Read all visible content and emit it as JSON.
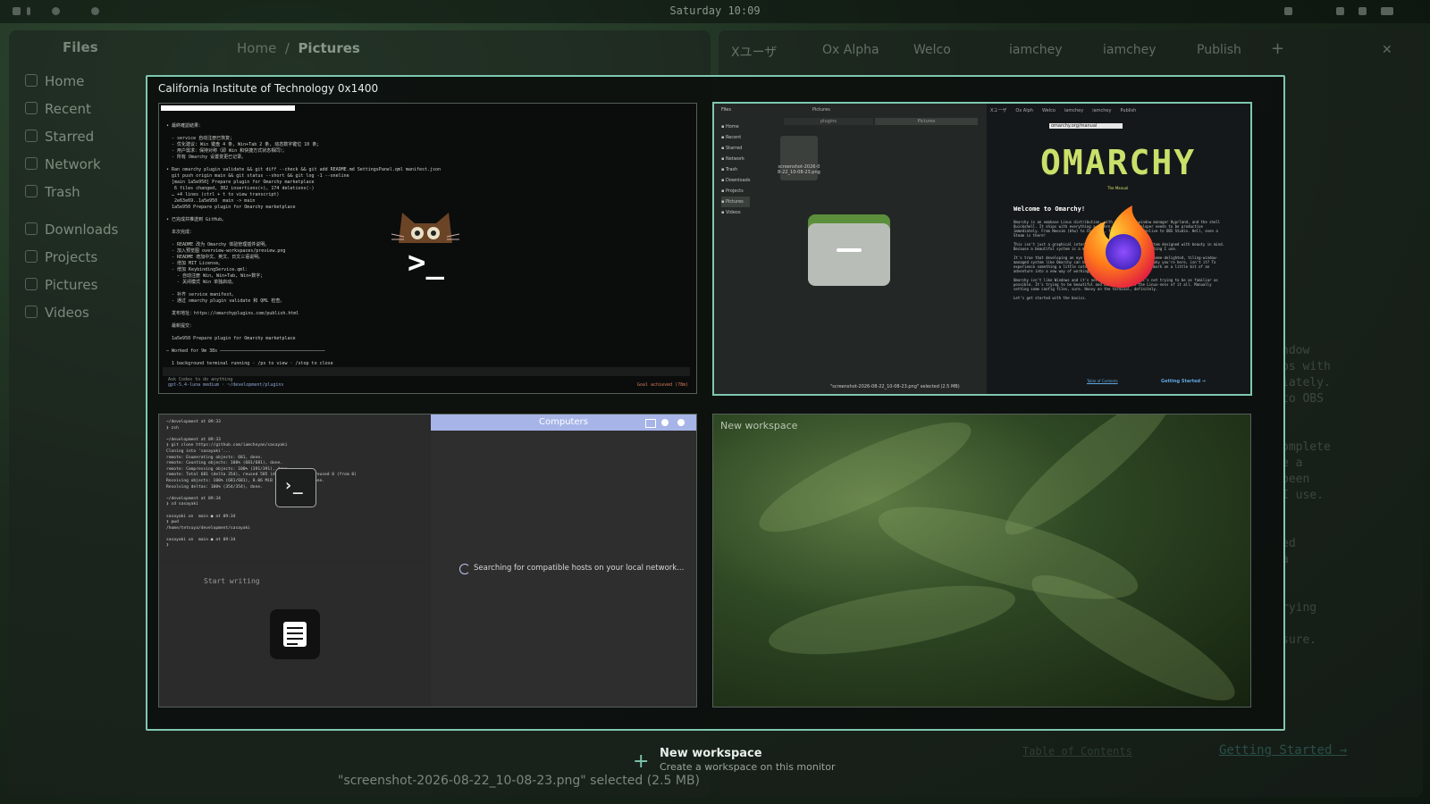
{
  "topbar": {
    "clock": "Saturday 10:09"
  },
  "files_window": {
    "title": "Files",
    "breadcrumb": [
      "Home",
      "Pictures"
    ],
    "sidebar": [
      {
        "label": "Home",
        "icon": "home-icon"
      },
      {
        "label": "Recent",
        "icon": "clock-icon"
      },
      {
        "label": "Starred",
        "icon": "star-icon"
      },
      {
        "label": "Network",
        "icon": "network-icon"
      },
      {
        "label": "Trash",
        "icon": "trash-icon"
      },
      {
        "label": "Downloads",
        "icon": "download-icon"
      },
      {
        "label": "Projects",
        "icon": "folder-icon"
      },
      {
        "label": "Pictures",
        "icon": "image-icon"
      },
      {
        "label": "Videos",
        "icon": "video-icon"
      }
    ],
    "status": "\"screenshot-2026-08-22_10-08-23.png\" selected  (2.5 MB)"
  },
  "browser_window": {
    "tabs": [
      "Xユーザ",
      "Ox Alpha",
      "Welco",
      "iamchey",
      "iamchey",
      "Publish"
    ],
    "ghost_lines": [
      "ndow",
      "ps with",
      "iately.",
      "to OBS",
      "",
      "",
      "omplete",
      "e a",
      "been",
      "I use.",
      "",
      "",
      "ed",
      "a",
      "",
      "",
      "rying",
      "",
      "sure."
    ],
    "footer_link_1": "Table of Contents",
    "footer_link_2": "Getting Started →"
  },
  "overview": {
    "title": "California Institute of Technology 0x1400",
    "ws1": {
      "terminal_lines": [
        "• 最終確認結果：",
        "",
        "  - service 自动注册已恢复；",
        "  - 优化建议: Win 键盘 4 条, Win+Tab 2 条, 动态数字键位 10 条；",
        "  - 用户需求：保持对称（即 Win 和快捷方式状态相同）；",
        "  - 所有 Omarchy 设置变更已记录。",
        "",
        "• Ran omarchy plugin validate && git diff --check && git add README.md SettingsPanel.qml manifest.json",
        "  git push origin main && git status --short && git log -1 --oneline",
        "  [main 1a5e950] Prepare plugin for Omarchy marketplace",
        "   6 files changed, 302 insertions(+), 174 deletions(-)",
        "  … +4 lines (ctrl + t to view transcript)",
        "   2e63e69..1a5e950  main -> main",
        "  1a5e950 Prepare plugin for Omarchy marketplace",
        "",
        "• 已完成并推送到 GitHub。",
        "",
        "  本次完成：",
        "",
        "  - README 改为 Omarchy 体验管理插件说明。",
        "  - 加入预览图 overview-workspaces/preview.png",
        "  - README 增加中文、英文、日文三语说明。",
        "  - 增加 MIT License。",
        "  - 增加 KeybindingService.qml：",
        "    - 自动注册 Win, Win+Tab, Win+数字；",
        "    - 关闭模式 Win 单独启动。",
        "",
        "  - 补齐 service manifest。",
        "  - 通过 omarchy plugin validate 和 QML 检查。",
        "",
        "  发布地址：https://omarchyplugins.com/publish.html",
        "",
        "  最新提交：",
        "",
        "  1a5e950 Prepare plugin for Omarchy marketplace",
        "",
        "─ Worked for 9m 38s ───────────────────────────────────────",
        "",
        "  1 background terminal running · /ps to view · /stop to close"
      ],
      "input_hint": "Ask Codex to do anything",
      "model_line": "gpt-5.4-luna medium · ~/development/plugins",
      "goal": "Goal achieved (78m)"
    },
    "ws2": {
      "files_sidebar": [
        "Home",
        "Recent",
        "Starred",
        "Network",
        "Trash",
        "Downloads",
        "Projects",
        "Pictures",
        "Videos"
      ],
      "files_tabs": [
        "plugins",
        "Pictures"
      ],
      "files_crumb": "Pictures",
      "file_name": "screenshot-2026-08-22_10-08-23.png",
      "files_status": "\"screenshot-2026-08-22_10-08-23.png\" selected (2.5 MB)",
      "browser_tabs": [
        "Xユーザ",
        "Ox Alph",
        "Welco",
        "iamchey",
        "iamchey",
        "Publish"
      ],
      "url": "omarchy.org/manual",
      "logo": "OMARCHY",
      "logo_sub": "The Manual",
      "welcome": "Welcome to Omarchy!",
      "paragraphs": [
        "Omarchy is an omakase Linux distribution, with the tiling window manager Hyprland, and the shell Quickshell. It ships with everything a modern, software developer needs to be productive immediately. From Neovim (btw) to Chromium, from Signal to Kdenlive to OBS Studio. Hell, even a Steam is there!",
        "This isn't just a graphical interface though. It's a complete system designed with beauty in mind. Because a beautiful system is a motivating system and just everything I use.",
        "It's true that developing an eye for this style of a TUI-heavy, theme-delighted, tiling-window-managed system like Omarchy can be an acquired taste. But that's why you're here, isn't it? To experience something a little outside of your comfort zone? To embark on a little bit of an adventure into a new way of working with computers? I hope so.",
        "Omarchy isn't like Windows and it's not like macOS either. It's not trying to be as familiar as possible. It's trying to be beautiful and better. Embrace the Linux-ness of it all. Manually setting some config files, sure. Hoovy on the terminal, definitely.",
        "Let's get started with the basics."
      ],
      "toc": "Table of Contents",
      "getting_started": "Getting Started →"
    },
    "ws3": {
      "term_lines": [
        "~/development at 09:33",
        "❯ zsh",
        "",
        "~/development at 09:33",
        "❯ git clone https://github.com/iamcheyan/sasayaki",
        "Cloning into 'sasayaki'...",
        "remote: Enumerating objects: 681, done.",
        "remote: Counting objects: 100% (681/681), done.",
        "remote: Compressing objects: 100% (391/391), done.",
        "remote: Total 681 (delta 354), reused 585 (delta 258), pack-reused 0 (from 0)",
        "Receiving objects: 100% (681/681), 8.06 MiB | 11.87 MiB/s, done.",
        "Resolving deltas: 100% (354/354), done.",
        "",
        "~/development at 09:34",
        "❯ cd sasayaki",
        "",
        "sasayaki on  main ● at 09:34",
        "❯ pwd",
        "/home/tetsuya/development/sasayaki",
        "",
        "sasayaki on  main ● at 09:34",
        "❯ "
      ],
      "computers_title": "Computers",
      "searching": "Searching for compatible hosts on your local network...",
      "writing_placeholder": "Start writing"
    },
    "ws4": {
      "label": "New workspace"
    }
  },
  "new_workspace": {
    "title": "New workspace",
    "subtitle": "Create a workspace on this monitor"
  }
}
